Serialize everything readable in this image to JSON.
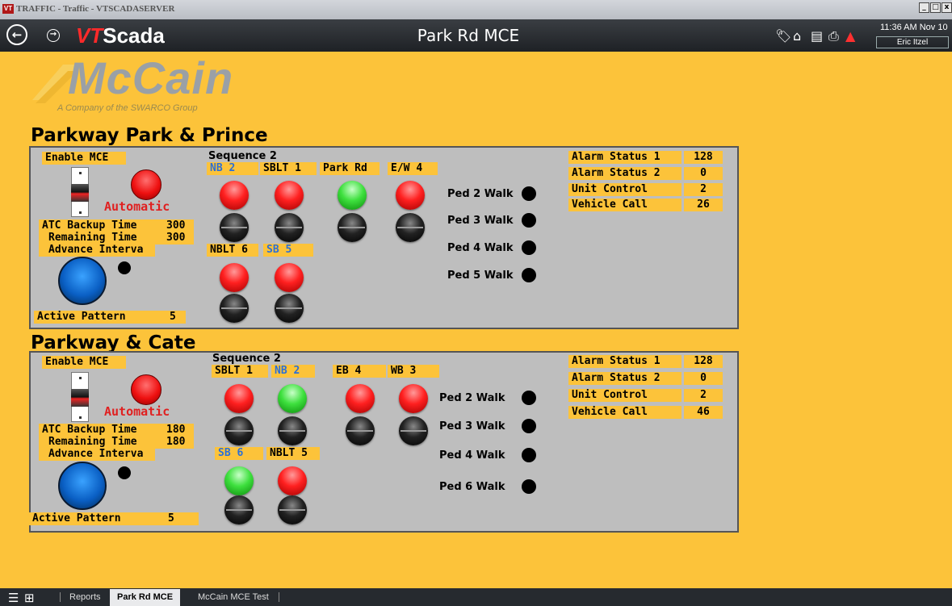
{
  "window": {
    "title": "TRAFFIC - Traffic - VTSCADASERVER",
    "app_glyph": "VT"
  },
  "header": {
    "brand_prefix": "VT",
    "brand_suffix": "Scada",
    "screen_title": "Park Rd MCE",
    "time": "11:36 AM Nov 10",
    "user": "Eric Itzel",
    "icons": [
      "back-arrow-icon",
      "forward-arrow-icon",
      "tag-icon",
      "home-network-icon",
      "report-icon",
      "print-icon",
      "alarm-bell-icon"
    ]
  },
  "logo": {
    "word": "McCain",
    "sub": "A Company of the SWARCO Group"
  },
  "panels": [
    {
      "title": "Parkway Park & Prince",
      "enable_label": "Enable MCE",
      "mode": "Automatic",
      "atc_label": "ATC Backup Time",
      "atc_value": "300",
      "remaining_label": "Remaining Time",
      "remaining_value": "300",
      "advance_label": "Advance Interva",
      "pattern_label": "Active Pattern",
      "pattern_value": "5",
      "sequence": "Sequence 2",
      "phases_top": [
        {
          "name": "NB",
          "num": "2"
        },
        {
          "name": "SBLT",
          "num": "1"
        },
        {
          "name": "Park Rd",
          "num": ""
        },
        {
          "name": "E/W",
          "num": "4"
        }
      ],
      "phases_bottom": [
        {
          "name": "NBLT",
          "num": "6"
        },
        {
          "name": "SB",
          "num": "5"
        }
      ],
      "top_lights": [
        "red",
        "red",
        "green",
        "red"
      ],
      "bottom_lights": [
        "red",
        "red"
      ],
      "peds": [
        "Ped 2 Walk",
        "Ped 3 Walk",
        "Ped 4 Walk",
        "Ped 5 Walk"
      ],
      "status": [
        {
          "label": "Alarm Status 1",
          "value": "128"
        },
        {
          "label": "Alarm Status 2",
          "value": "0"
        },
        {
          "label": "Unit Control",
          "value": "2"
        },
        {
          "label": "Vehicle Call",
          "value": "26"
        }
      ]
    },
    {
      "title": "Parkway & Cate",
      "enable_label": "Enable MCE",
      "mode": "Automatic",
      "atc_label": "ATC Backup Time",
      "atc_value": "180",
      "remaining_label": "Remaining Time",
      "remaining_value": "180",
      "advance_label": "Advance Interva",
      "pattern_label": "Active Pattern",
      "pattern_value": "5",
      "sequence": "Sequence 2",
      "phases_top": [
        {
          "name": "SBLT",
          "num": "1"
        },
        {
          "name": "NB",
          "num": "2"
        },
        {
          "name": "EB",
          "num": "4"
        },
        {
          "name": "WB",
          "num": "3"
        }
      ],
      "phases_bottom": [
        {
          "name": "SB",
          "num": "6"
        },
        {
          "name": "NBLT",
          "num": "5"
        }
      ],
      "top_lights": [
        "red",
        "green",
        "red",
        "red"
      ],
      "bottom_lights": [
        "green",
        "red"
      ],
      "peds": [
        "Ped 2 Walk",
        "Ped 3 Walk",
        "Ped 4 Walk",
        "Ped 6 Walk"
      ],
      "status": [
        {
          "label": "Alarm Status 1",
          "value": "128"
        },
        {
          "label": "Alarm Status 2",
          "value": "0"
        },
        {
          "label": "Unit Control",
          "value": "2"
        },
        {
          "label": "Vehicle Call",
          "value": "46"
        }
      ]
    }
  ],
  "taskbar": {
    "tabs": [
      "Reports",
      "Park Rd MCE",
      "McCain MCE Test"
    ],
    "active": "Park Rd MCE"
  },
  "colors": {
    "background": "#fcc33a",
    "panel": "#bebebe",
    "accent_blue": "#2b6fd8",
    "alert_red": "#e02020"
  }
}
